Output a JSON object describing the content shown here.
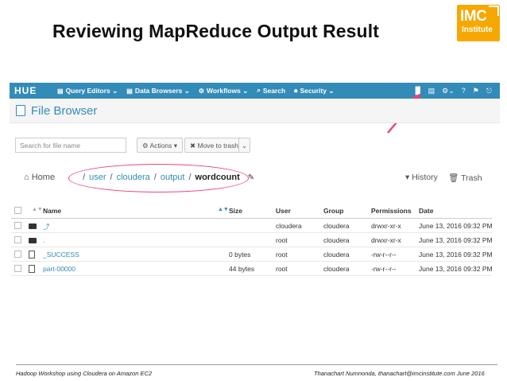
{
  "slide": {
    "title": "Reviewing MapReduce Output Result",
    "logo_main": "IMC",
    "logo_sub": "Institute"
  },
  "nav": {
    "logo": "HUE",
    "items": [
      {
        "label": "Query Editors ⌄",
        "icon": "query-editors-icon"
      },
      {
        "label": "Data Browsers ⌄",
        "icon": "data-browsers-icon"
      },
      {
        "label": "Workflows ⌄",
        "icon": "workflows-icon"
      },
      {
        "label": "Search",
        "icon": "search-icon"
      },
      {
        "label": "Security ⌄",
        "icon": "security-icon"
      }
    ],
    "brand_color": "#338bb8"
  },
  "file_browser": {
    "title": "File Browser",
    "search_placeholder": "Search for file name",
    "actions_label": "⚙ Actions ▾",
    "move_to_trash_label": "✖ Move to trash",
    "breadcrumb": {
      "home": "Home",
      "parts": [
        "user",
        "cloudera",
        "output"
      ],
      "current": "wordcount"
    },
    "history_label": "▾ History",
    "trash_label": "Trash"
  },
  "table": {
    "headers": {
      "name": "Name",
      "size": "Size",
      "user": "User",
      "group": "Group",
      "permissions": "Permissions",
      "date": "Date"
    },
    "rows": [
      {
        "type": "folder",
        "name": "⤴",
        "size": "",
        "user": "cloudera",
        "group": "cloudera",
        "permissions": "drwxr-xr-x",
        "date": "June 13, 2016 09:32 PM"
      },
      {
        "type": "folder",
        "name": ".",
        "size": "",
        "user": "root",
        "group": "cloudera",
        "permissions": "drwxr-xr-x",
        "date": "June 13, 2016 09:32 PM"
      },
      {
        "type": "file",
        "name": "_SUCCESS",
        "size": "0 bytes",
        "user": "root",
        "group": "cloudera",
        "permissions": "-rw-r--r--",
        "date": "June 13, 2016 09:32 PM"
      },
      {
        "type": "file",
        "name": "part-00000",
        "size": "44 bytes",
        "user": "root",
        "group": "cloudera",
        "permissions": "-rw-r--r--",
        "date": "June 13, 2016 09:32 PM"
      }
    ]
  },
  "footer": {
    "left": "Hadoop Workshop using Cloudera on Amazon EC2",
    "right": "Thanachart Numnonda,  thanachart@imcinstitute.com  June 2016"
  },
  "annotation_color": "#e8457a"
}
